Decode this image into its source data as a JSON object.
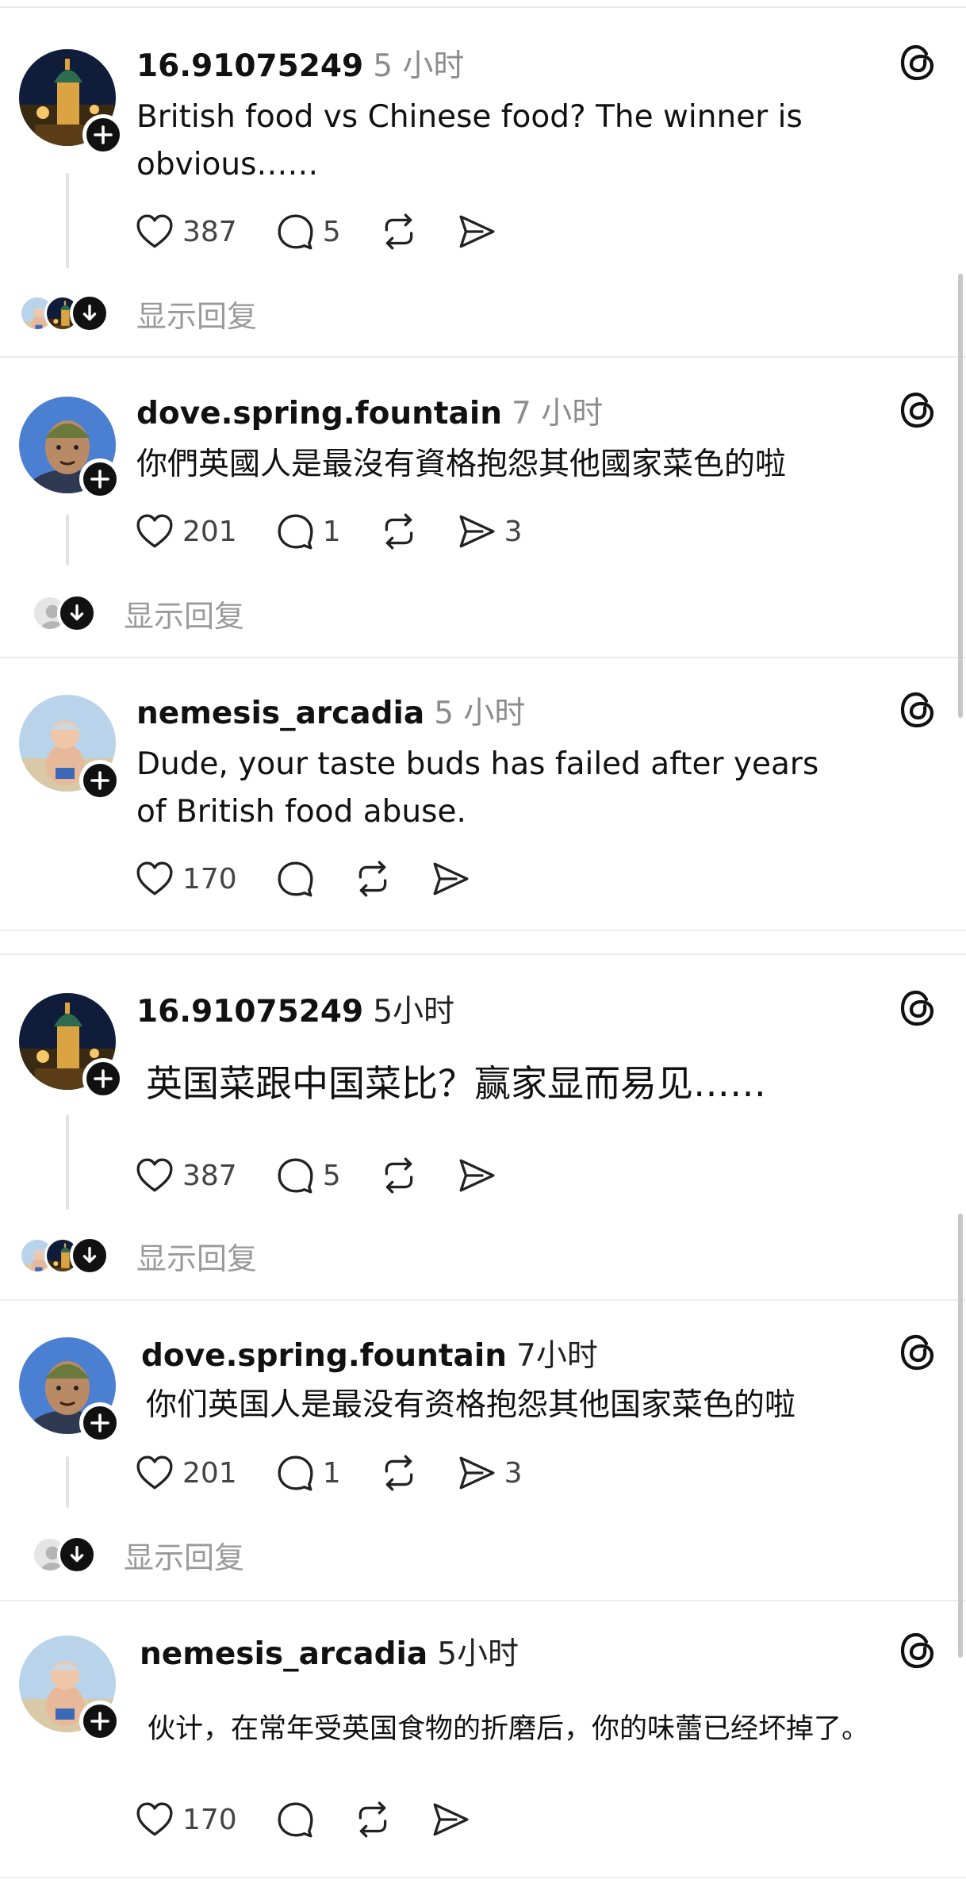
{
  "posts": [
    {
      "username": "16.91075249",
      "time": "5 小时",
      "text": "British food vs Chinese food?   The winner is obvious……",
      "likes": "387",
      "comments": "5",
      "reposts": "",
      "shares": "",
      "show_replies": "显示回复"
    },
    {
      "username": "dove.spring.fountain",
      "time": "7 小时",
      "text": "你們英國人是最沒有資格抱怨其他國家菜色的啦",
      "likes": "201",
      "comments": "1",
      "reposts": "",
      "shares": "3",
      "show_replies": "显示回复"
    },
    {
      "username": "nemesis_arcadia",
      "time": "5 小时",
      "text": "Dude, your taste buds has failed after years of British food abuse.",
      "likes": "170",
      "comments": "",
      "reposts": "",
      "shares": ""
    },
    {
      "username": "16.91075249",
      "time": "5小时",
      "text": "英国菜跟中国菜比？赢家显而易见……",
      "likes": "387",
      "comments": "5",
      "reposts": "",
      "shares": "",
      "show_replies": "显示回复"
    },
    {
      "username": "dove.spring.fountain",
      "time": "7小时",
      "text": "你们英国人是最没有资格抱怨其他国家菜色的啦",
      "likes": "201",
      "comments": "1",
      "reposts": "",
      "shares": "3",
      "show_replies": "显示回复"
    },
    {
      "username": "nemesis_arcadia",
      "time": "5小时",
      "text": "伙计，在常年受英国食物的折磨后，你的味蕾已经坏掉了。",
      "likes": "170",
      "comments": "",
      "reposts": "",
      "shares": ""
    }
  ],
  "icons": {
    "follow": "plus-icon",
    "app": "threads-logo-icon",
    "like": "heart-icon",
    "comment": "comment-bubble-icon",
    "repost": "repost-icon",
    "share": "send-icon",
    "expand": "arrow-down-icon"
  },
  "colors": {
    "text": "#111111",
    "muted": "#8c8c8c",
    "separator": "#ececec",
    "thread_line": "#e3e3e3"
  }
}
